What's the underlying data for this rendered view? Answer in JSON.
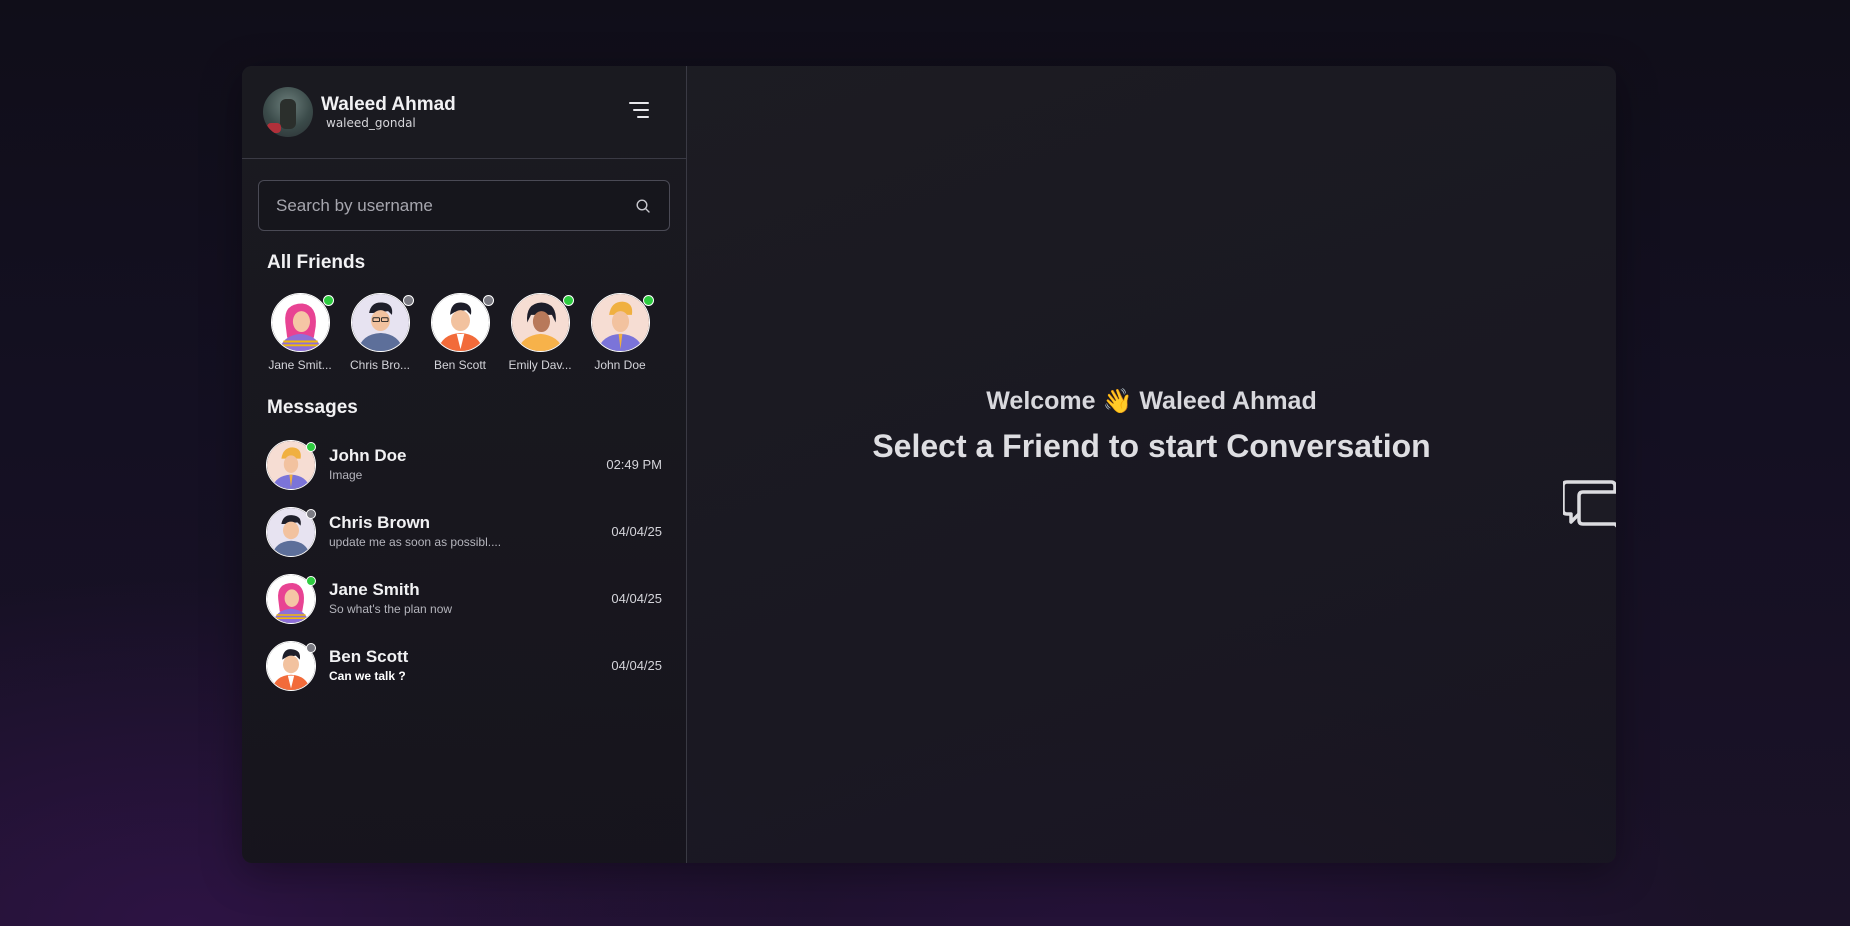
{
  "profile": {
    "full_name": "Waleed Ahmad",
    "username": "waleed_gondal"
  },
  "search": {
    "placeholder": "Search by username",
    "value": ""
  },
  "friends_section": {
    "title": "All Friends",
    "items": [
      {
        "name": "Jane Smit...",
        "status": "online",
        "avatar": "woman-pink-hair"
      },
      {
        "name": "Chris Bro...",
        "status": "offline",
        "avatar": "man-glasses"
      },
      {
        "name": "Ben Scott",
        "status": "offline",
        "avatar": "man-orange-shirt"
      },
      {
        "name": "Emily Dav...",
        "status": "online",
        "avatar": "woman-yellow-top"
      },
      {
        "name": "John Doe",
        "status": "online",
        "avatar": "man-turban"
      }
    ]
  },
  "messages_section": {
    "title": "Messages",
    "items": [
      {
        "name": "John Doe",
        "preview": "Image",
        "time": "02:49 PM",
        "status": "online",
        "unread": false
      },
      {
        "name": "Chris Brown",
        "preview": "update me as soon as possibl....",
        "time": "04/04/25",
        "status": "offline",
        "unread": false
      },
      {
        "name": "Jane Smith",
        "preview": "So what's the plan now",
        "time": "04/04/25",
        "status": "online",
        "unread": false
      },
      {
        "name": "Ben Scott",
        "preview": "Can we talk ?",
        "time": "04/04/25",
        "status": "offline",
        "unread": true
      }
    ]
  },
  "main": {
    "welcome_prefix": "Welcome",
    "welcome_emoji": "👋",
    "welcome_name": "Waleed Ahmad",
    "select_text": "Select a Friend to start Conversation",
    "icon": "chat-bubbles-icon"
  },
  "colors": {
    "online": "#2ecc40",
    "offline": "#7a7a82",
    "panel_border": "#3a3a44"
  }
}
